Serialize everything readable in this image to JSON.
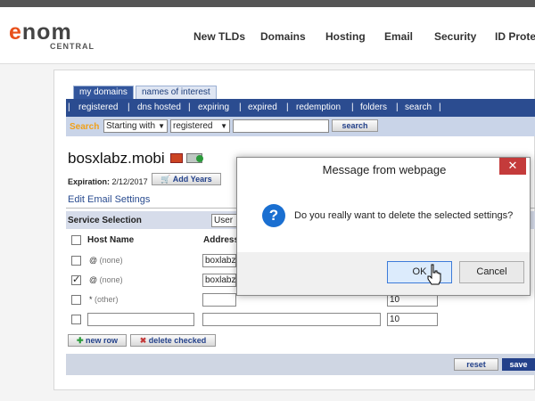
{
  "logo": {
    "word_e": "e",
    "word_rest": "nom",
    "sub": "CENTRAL"
  },
  "nav": [
    "New TLDs",
    "Domains",
    "Hosting",
    "Email",
    "Security",
    "ID Protec"
  ],
  "tabs": {
    "active": "my domains",
    "inactive": "names of interest"
  },
  "links": [
    "|",
    "registered",
    "|",
    "dns hosted",
    "|",
    "expiring",
    "|",
    "expired",
    "|",
    "redemption",
    "|",
    "folders",
    "|",
    "search",
    "|"
  ],
  "search": {
    "label": "Search",
    "match_select": "Starting with",
    "status_select": "registered",
    "query": "",
    "button": "search"
  },
  "domain": {
    "name": "bosxlabz.mobi",
    "expiration_label": "Expiration:",
    "expiration_date": "2/12/2017",
    "add_years": "Add Years"
  },
  "email_settings": {
    "title": "Edit Email Settings",
    "service_label": "Service Selection",
    "service_value": "User",
    "col_host": "Host Name",
    "col_address": "Address",
    "rows": [
      {
        "host": "@",
        "note": "(none)",
        "address": "boxlabz-",
        "pref": "",
        "checked": false
      },
      {
        "host": "@",
        "note": "(none)",
        "address": "boxlabz-",
        "pref": "",
        "checked": true
      },
      {
        "host": "*",
        "note": "(other)",
        "address": "",
        "pref": "",
        "checked": false
      },
      {
        "host": "",
        "note": "",
        "address": "",
        "pref": "10",
        "checked": false
      }
    ],
    "pref_row3": "10",
    "new_row": "new row",
    "delete_checked": "delete checked",
    "reset": "reset",
    "save": "save"
  },
  "dialog": {
    "title": "Message from webpage",
    "close": "✕",
    "icon": "?",
    "message": "Do you really want to delete the selected settings?",
    "ok": "OK",
    "cancel": "Cancel"
  },
  "colors": {
    "accent": "#e8501a",
    "nav_bar": "#2b4c90",
    "dialog_ok": "#dcebfc",
    "close": "#c43b3b"
  }
}
